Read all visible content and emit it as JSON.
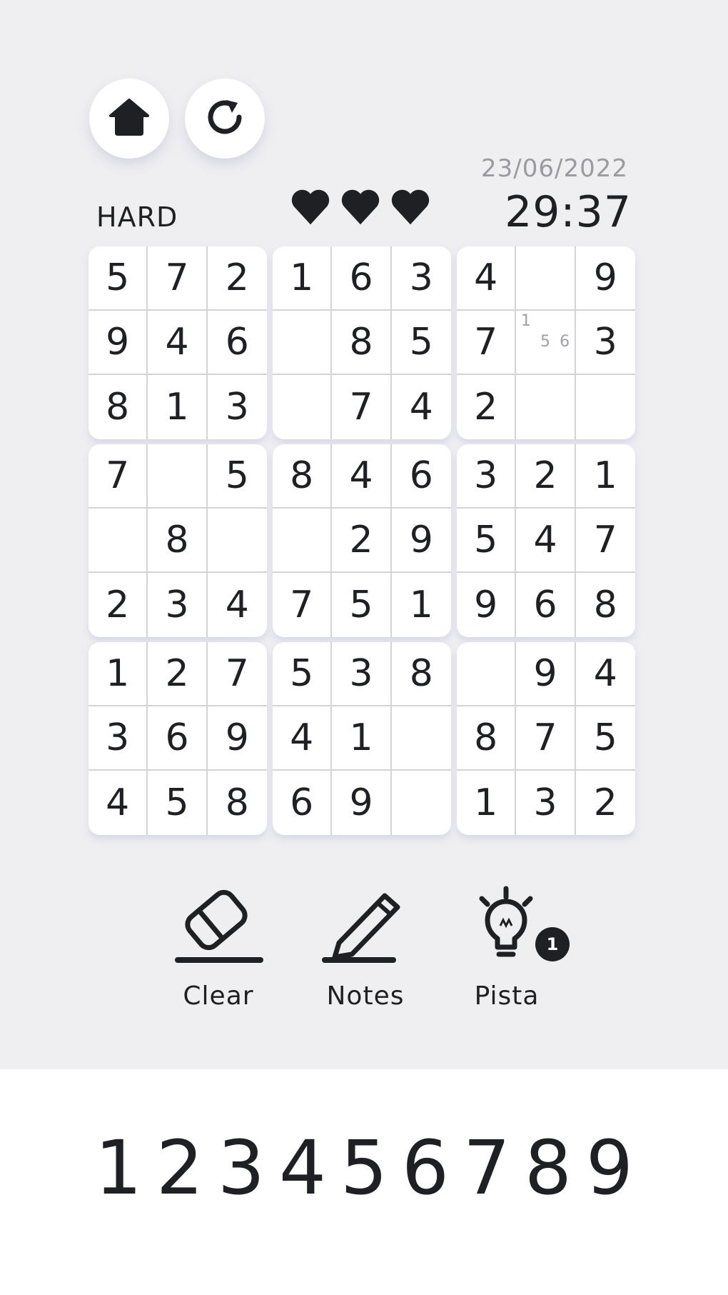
{
  "header": {
    "date": "23/06/2022",
    "difficulty": "HARD",
    "timer": "29:37",
    "lives": 3
  },
  "board": {
    "cells": [
      [
        "5",
        "7",
        "2",
        "1",
        "6",
        "3",
        "4",
        "",
        "9"
      ],
      [
        "9",
        "4",
        "6",
        "",
        "8",
        "5",
        "7",
        "",
        "3"
      ],
      [
        "8",
        "1",
        "3",
        "",
        "7",
        "4",
        "2",
        "",
        ""
      ],
      [
        "7",
        "",
        "5",
        "8",
        "4",
        "6",
        "3",
        "2",
        "1"
      ],
      [
        "",
        "8",
        "",
        "",
        "2",
        "9",
        "5",
        "4",
        "7"
      ],
      [
        "2",
        "3",
        "4",
        "7",
        "5",
        "1",
        "9",
        "6",
        "8"
      ],
      [
        "1",
        "2",
        "7",
        "5",
        "3",
        "8",
        "",
        "9",
        "4"
      ],
      [
        "3",
        "6",
        "9",
        "4",
        "1",
        "",
        "8",
        "7",
        "5"
      ],
      [
        "4",
        "5",
        "8",
        "6",
        "9",
        "",
        "1",
        "3",
        "2"
      ]
    ],
    "notes": [
      {
        "row": 1,
        "col": 7,
        "values": [
          "1",
          "",
          "",
          "",
          "5",
          "6",
          "",
          "",
          ""
        ]
      }
    ]
  },
  "tools": {
    "clear_label": "Clear",
    "notes_label": "Notes",
    "hint_label": "Pista",
    "hint_count": "1"
  },
  "numpad": [
    "1",
    "2",
    "3",
    "4",
    "5",
    "6",
    "7",
    "8",
    "9"
  ],
  "icons": {
    "home": "home-icon",
    "restart": "restart-icon",
    "heart": "heart-icon",
    "eraser": "eraser-icon",
    "pencil": "pencil-icon",
    "lightbulb": "lightbulb-icon"
  }
}
